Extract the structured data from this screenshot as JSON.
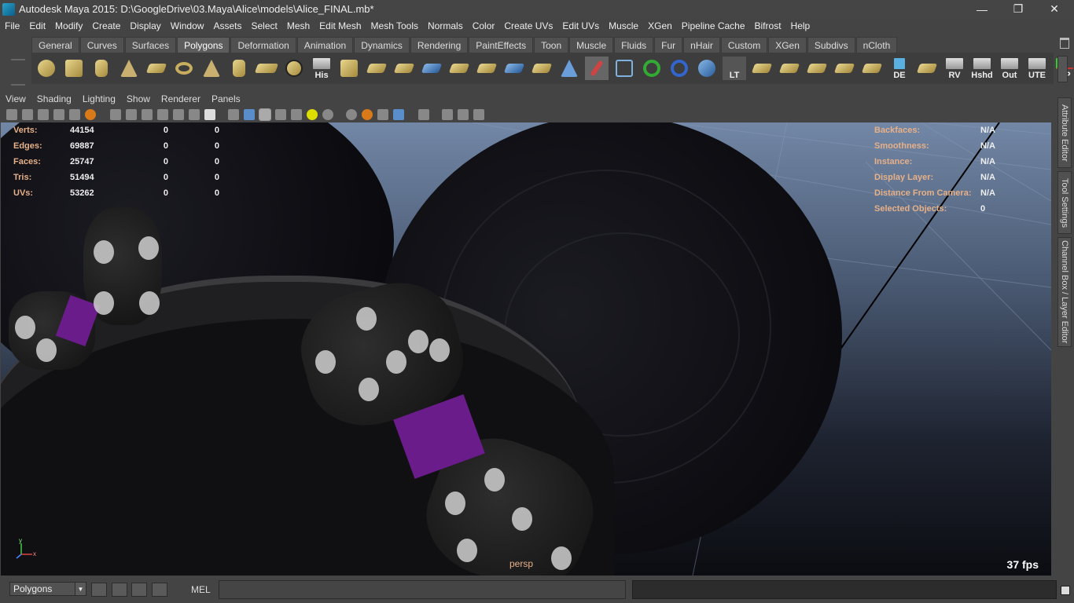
{
  "window": {
    "title": "Autodesk Maya 2015: D:\\GoogleDrive\\03.Maya\\Alice\\models\\Alice_FINAL.mb*",
    "controls": [
      "—",
      "❐",
      "✕"
    ]
  },
  "menubar": [
    "File",
    "Edit",
    "Modify",
    "Create",
    "Display",
    "Window",
    "Assets",
    "Select",
    "Mesh",
    "Edit Mesh",
    "Mesh Tools",
    "Normals",
    "Color",
    "Create UVs",
    "Edit UVs",
    "Muscle",
    "XGen",
    "Pipeline Cache",
    "Bifrost",
    "Help"
  ],
  "shelf": {
    "tabs": [
      "General",
      "Curves",
      "Surfaces",
      "Polygons",
      "Deformation",
      "Animation",
      "Dynamics",
      "Rendering",
      "PaintEffects",
      "Toon",
      "Muscle",
      "Fluids",
      "Fur",
      "nHair",
      "Custom",
      "XGen",
      "Subdivs",
      "nCloth"
    ],
    "active_tab": "Polygons",
    "labeled_icons": {
      "his": "His",
      "lt": "LT",
      "de": "DE",
      "rv": "RV",
      "hshd": "Hshd",
      "out": "Out",
      "ute": "UTE",
      "cp": "CP"
    }
  },
  "viewport": {
    "menu": [
      "View",
      "Shading",
      "Lighting",
      "Show",
      "Renderer",
      "Panels"
    ],
    "camera": "persp",
    "fps": "37 fps",
    "axis_labels": {
      "y": "y",
      "x": "x"
    },
    "stats": [
      {
        "label": "Verts:",
        "value": "44154",
        "sel": "0",
        "comp": "0"
      },
      {
        "label": "Edges:",
        "value": "69887",
        "sel": "0",
        "comp": "0"
      },
      {
        "label": "Faces:",
        "value": "25747",
        "sel": "0",
        "comp": "0"
      },
      {
        "label": "Tris:",
        "value": "51494",
        "sel": "0",
        "comp": "0"
      },
      {
        "label": "UVs:",
        "value": "53262",
        "sel": "0",
        "comp": "0"
      }
    ],
    "info": [
      {
        "label": "Backfaces:",
        "value": "N/A"
      },
      {
        "label": "Smoothness:",
        "value": "N/A"
      },
      {
        "label": "Instance:",
        "value": "N/A"
      },
      {
        "label": "Display Layer:",
        "value": "N/A"
      },
      {
        "label": "Distance From Camera:",
        "value": "N/A"
      },
      {
        "label": "Selected Objects:",
        "value": "0"
      }
    ]
  },
  "side_tabs": [
    "Attribute Editor",
    "Tool Settings",
    "Channel Box / Layer Editor"
  ],
  "bottom": {
    "mode": "Polygons",
    "mel_label": "MEL"
  },
  "colors": {
    "accent_label": "#e6b088",
    "bow_band": "#6a1c8a"
  }
}
